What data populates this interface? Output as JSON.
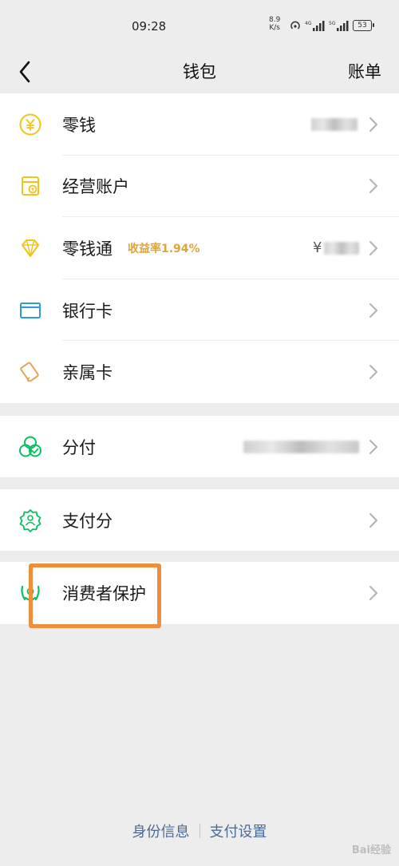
{
  "status_bar": {
    "time": "09:28",
    "speed_value": "8.9",
    "speed_unit": "K/s",
    "battery": "53"
  },
  "nav": {
    "title": "钱包",
    "right_label": "账单"
  },
  "items": [
    {
      "label": "零钱",
      "icon": "coin-icon",
      "color": "#f0c419"
    },
    {
      "label": "经营账户",
      "icon": "shop-account-icon",
      "color": "#f0c419"
    },
    {
      "label": "零钱通",
      "tag": "收益率1.94%",
      "balance_prefix": "¥",
      "icon": "diamond-icon",
      "color": "#f0c419"
    },
    {
      "label": "银行卡",
      "icon": "bank-card-icon",
      "color": "#2f9ae0"
    },
    {
      "label": "亲属卡",
      "icon": "family-card-icon",
      "color": "#e8a350"
    },
    {
      "label": "分付",
      "icon": "fenfu-icon",
      "color": "#07c160"
    },
    {
      "label": "支付分",
      "icon": "pay-score-icon",
      "color": "#07c160"
    },
    {
      "label": "消费者保护",
      "icon": "consumer-protection-icon",
      "color": "#07c160"
    }
  ],
  "footer": {
    "identity_info": "身份信息",
    "payment_settings": "支付设置"
  },
  "watermark": "Bai经验"
}
